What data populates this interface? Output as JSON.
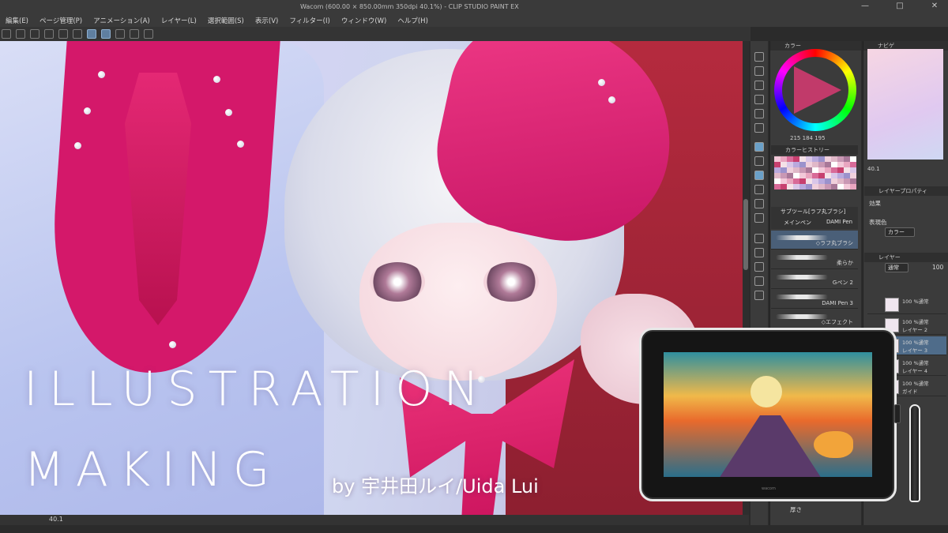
{
  "app": {
    "title": "Wacom (600.00 × 850.00mm 350dpi 40.1%) - CLIP STUDIO PAINT EX",
    "window_controls": [
      "—",
      "□",
      "✕"
    ]
  },
  "menu": [
    "編集(E)",
    "ページ管理(P)",
    "アニメーション(A)",
    "レイヤー(L)",
    "選択範囲(S)",
    "表示(V)",
    "フィルター(I)",
    "ウィンドウ(W)",
    "ヘルプ(H)"
  ],
  "status": {
    "zoom": "40.1"
  },
  "color_panel": {
    "tab": "カラー",
    "rgb": [
      "215",
      "184",
      "195"
    ],
    "history_tab": "カラーヒストリー"
  },
  "brush_panel": {
    "tabs": [
      "サブツール[ラフ丸ブラシ]",
      "メインペン",
      "DAMI Pen"
    ],
    "brushes": [
      "◇ラフ丸ブラシ",
      "柔らか",
      "Gペン 2",
      "DAMI Pen 3",
      "◇エフェクト"
    ]
  },
  "navigator": {
    "tab": "ナビゲ",
    "zoom": "40.1"
  },
  "layer_property": {
    "tab": "レイヤープロパティ",
    "effect_label": "効果",
    "expression_label": "表現色",
    "expression_value": "カラー"
  },
  "layers": {
    "tab": "レイヤー",
    "blend_mode": "通常",
    "opacity": "100",
    "rows": [
      {
        "mode": "100 %通常",
        "name": ""
      },
      {
        "mode": "100 %通常",
        "name": "レイヤー 2"
      },
      {
        "mode": "100 %通常",
        "name": "レイヤー 3"
      },
      {
        "mode": "100 %通常",
        "name": "レイヤー 4"
      },
      {
        "mode": "100 %通常",
        "name": "ガイド"
      }
    ]
  },
  "thickness_label": "厚さ",
  "overlay": {
    "line1": "ILLUSTRATION",
    "line2": "MAKING",
    "byline": "by 宇井田ルイ/Uida Lui"
  },
  "tablet": {
    "brand": "wacom"
  },
  "colors": {
    "accent_pink": "#e42874",
    "ui_dark": "#3b3b3b",
    "selected_layer": "#4f6c8a"
  }
}
